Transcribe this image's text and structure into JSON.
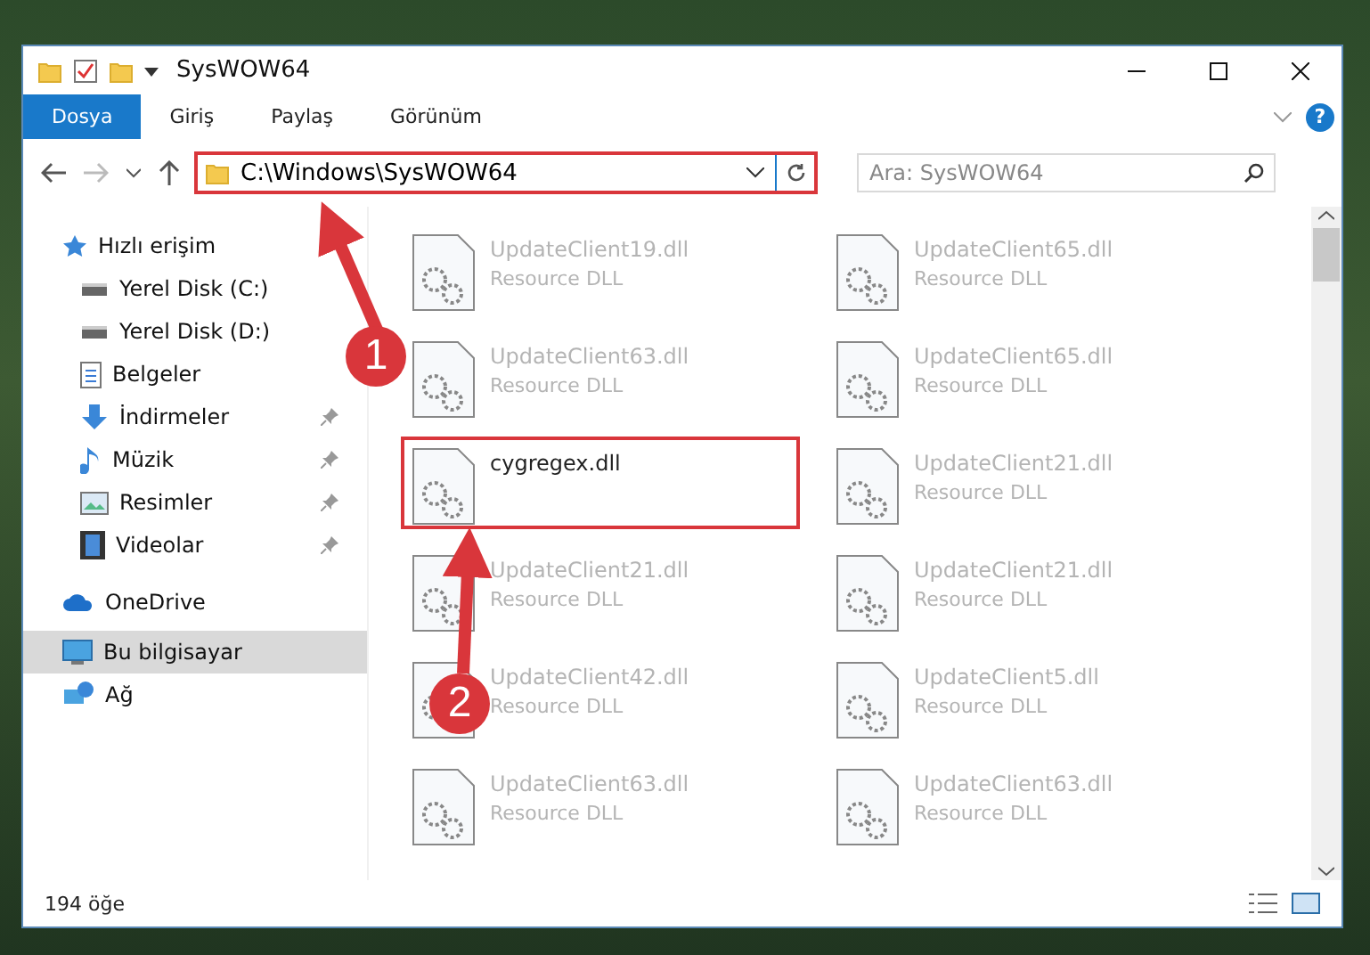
{
  "window": {
    "title": "SysWOW64"
  },
  "ribbon_tabs": [
    {
      "label": "Dosya",
      "selected": true
    },
    {
      "label": "Giriş",
      "selected": false
    },
    {
      "label": "Paylaş",
      "selected": false
    },
    {
      "label": "Görünüm",
      "selected": false
    }
  ],
  "address_bar": {
    "path": "C:\\Windows\\SysWOW64",
    "highlighted": true
  },
  "help_button": {
    "label": "?"
  },
  "search": {
    "placeholder": "Ara: SysWOW64"
  },
  "sidebar": {
    "items": [
      {
        "label": "Hızlı erişim",
        "kind": "star",
        "pinned": false,
        "selected": false
      },
      {
        "label": "Yerel Disk (C:)",
        "kind": "drive",
        "pinned": false,
        "selected": false
      },
      {
        "label": "Yerel Disk (D:)",
        "kind": "drive",
        "pinned": false,
        "selected": false
      },
      {
        "label": "Belgeler",
        "kind": "document",
        "pinned": false,
        "selected": false
      },
      {
        "label": "İndirmeler",
        "kind": "download",
        "pinned": true,
        "selected": false
      },
      {
        "label": "Müzik",
        "kind": "music",
        "pinned": true,
        "selected": false
      },
      {
        "label": "Resimler",
        "kind": "picture",
        "pinned": true,
        "selected": false
      },
      {
        "label": "Videolar",
        "kind": "video",
        "pinned": true,
        "selected": false
      },
      {
        "label": "OneDrive",
        "kind": "cloud",
        "pinned": false,
        "selected": false
      },
      {
        "label": "Bu bilgisayar",
        "kind": "computer",
        "pinned": false,
        "selected": true
      },
      {
        "label": "Ağ",
        "kind": "network",
        "pinned": false,
        "selected": false
      }
    ]
  },
  "files": [
    {
      "name": "UpdateClient19.dll",
      "type": "Resource DLL",
      "highlighted": false
    },
    {
      "name": "UpdateClient65.dll",
      "type": "Resource DLL",
      "highlighted": false
    },
    {
      "name": "UpdateClient63.dll",
      "type": "Resource DLL",
      "highlighted": false
    },
    {
      "name": "UpdateClient65.dll",
      "type": "Resource DLL",
      "highlighted": false
    },
    {
      "name": "cygregex.dll",
      "highlighted": true
    },
    {
      "name": "UpdateClient21.dll",
      "type": "Resource DLL",
      "highlighted": false
    },
    {
      "name": "UpdateClient21.dll",
      "type": "Resource DLL",
      "highlighted": false
    },
    {
      "name": "UpdateClient21.dll",
      "type": "Resource DLL",
      "highlighted": false
    },
    {
      "name": "UpdateClient42.dll",
      "type": "Resource DLL",
      "highlighted": false
    },
    {
      "name": "UpdateClient5.dll",
      "type": "Resource DLL",
      "highlighted": false
    },
    {
      "name": "UpdateClient63.dll",
      "type": "Resource DLL",
      "highlighted": false
    },
    {
      "name": "UpdateClient63.dll",
      "type": "Resource DLL",
      "highlighted": false
    }
  ],
  "status_bar": {
    "item_count": "194 öğe"
  },
  "annotations": [
    {
      "number": "1"
    },
    {
      "number": "2"
    }
  ]
}
